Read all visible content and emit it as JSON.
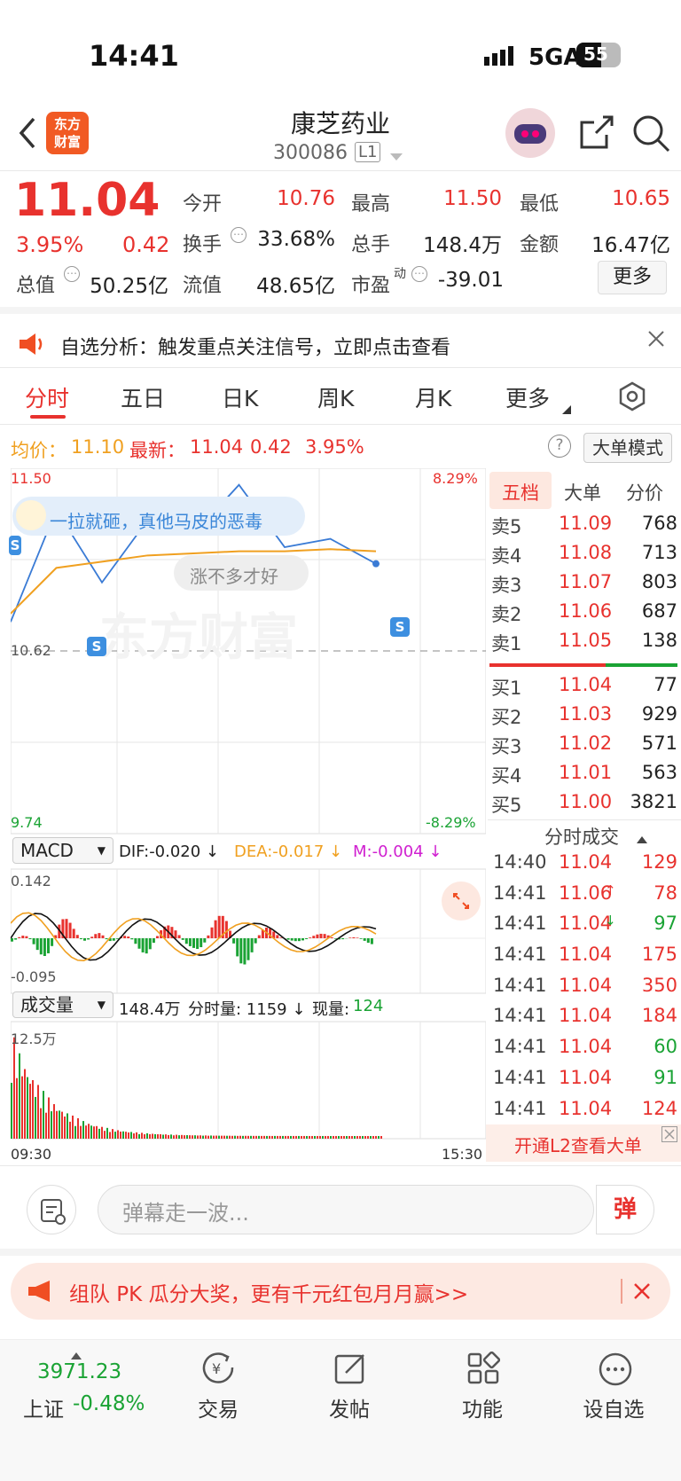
{
  "status": {
    "time": "14:41",
    "network": "5GA",
    "battery": "55"
  },
  "header": {
    "stock_name": "康芝药业",
    "stock_code": "300086",
    "level_badge": "L1",
    "logo_text": "东方\n财富",
    "back_icon": "chevron-left-icon",
    "share_icon": "share-icon",
    "search_icon": "search-icon"
  },
  "quote": {
    "price": "11.04",
    "change_pct": "3.95%",
    "change": "0.42",
    "open_label": "今开",
    "open": "10.76",
    "high_label": "最高",
    "high": "11.50",
    "low_label": "最低",
    "low": "10.65",
    "turnover_label": "换手",
    "turnover": "33.68%",
    "volume_label": "总手",
    "volume": "148.4万",
    "amount_label": "金额",
    "amount": "16.47亿",
    "mktcap_label": "总值",
    "mktcap": "50.25亿",
    "float_label": "流值",
    "float": "48.65亿",
    "pe_label": "市盈",
    "pe_sup": "动",
    "pe": "-39.01",
    "more_label": "更多"
  },
  "notice": {
    "text": "自选分析：触发重点关注信号，立即点击查看"
  },
  "tabs": [
    {
      "label": "分时"
    },
    {
      "label": "五日"
    },
    {
      "label": "日K"
    },
    {
      "label": "周K"
    },
    {
      "label": "月K"
    },
    {
      "label": "更多"
    }
  ],
  "info_row": {
    "avg_label": "均价：",
    "avg": "11.10",
    "last_label": "最新：",
    "last": "11.04",
    "chg": "0.42",
    "pct": "3.95%",
    "mode_btn": "大单模式"
  },
  "chart": {
    "y_high": "11.50",
    "y_ref": "10.62",
    "y_low": "9.74",
    "pct_high": "8.29%",
    "pct_low": "-8.29%",
    "time_start": "09:30",
    "time_end": "15:30",
    "comment_1": "一拉就砸，真他马皮的恶毒",
    "comment_2": "涨不多才好",
    "watermark": "东方财富",
    "macd_label": "MACD",
    "dif": "DIF:-0.020 ↓",
    "dea": "DEA:-0.017 ↓",
    "m": "M:-0.004 ↓",
    "macd_top": "0.142",
    "macd_bottom": "-0.095",
    "vol_label": "成交量",
    "vol_total": "148.4万",
    "vol_fenshi": "分时量: 1159 ↓",
    "vol_now_label": "现量:",
    "vol_now": "124",
    "vol_max": "12.5万",
    "s_mark": "S"
  },
  "chart_data": {
    "type": "line",
    "title": "",
    "x": [
      "09:30",
      "10:00",
      "10:30",
      "11:00",
      "11:30",
      "13:30",
      "14:00",
      "14:30",
      "14:41"
    ],
    "series": [
      {
        "name": "",
        "values": [
          10.76,
          11.3,
          10.95,
          11.25,
          11.18,
          11.42,
          11.12,
          11.16,
          11.04
        ]
      },
      {
        "name": "均价",
        "values": [
          10.8,
          11.02,
          11.05,
          11.08,
          11.09,
          11.1,
          11.1,
          11.11,
          11.1
        ]
      }
    ],
    "ylim": [
      9.74,
      11.5
    ],
    "reference": 10.62
  },
  "order_book": {
    "tabs": [
      {
        "label": "五档"
      },
      {
        "label": "大单"
      },
      {
        "label": "分价"
      }
    ],
    "asks": [
      {
        "label": "卖5",
        "price": "11.09",
        "vol": "768"
      },
      {
        "label": "卖4",
        "price": "11.08",
        "vol": "713"
      },
      {
        "label": "卖3",
        "price": "11.07",
        "vol": "803"
      },
      {
        "label": "卖2",
        "price": "11.06",
        "vol": "687"
      },
      {
        "label": "卖1",
        "price": "11.05",
        "vol": "138"
      }
    ],
    "bids": [
      {
        "label": "买1",
        "price": "11.04",
        "vol": "77"
      },
      {
        "label": "买2",
        "price": "11.03",
        "vol": "929"
      },
      {
        "label": "买3",
        "price": "11.02",
        "vol": "571"
      },
      {
        "label": "买4",
        "price": "11.01",
        "vol": "563"
      },
      {
        "label": "买5",
        "price": "11.00",
        "vol": "3821"
      }
    ],
    "trades_title": "分时成交",
    "trades": [
      {
        "time": "14:40",
        "price": "11.04",
        "vol": "129",
        "dir": ""
      },
      {
        "time": "14:41",
        "price": "11.06",
        "vol": "78",
        "dir": "↑"
      },
      {
        "time": "14:41",
        "price": "11.04",
        "vol": "97",
        "dir": "↓"
      },
      {
        "time": "14:41",
        "price": "11.04",
        "vol": "175",
        "dir": ""
      },
      {
        "time": "14:41",
        "price": "11.04",
        "vol": "350",
        "dir": ""
      },
      {
        "time": "14:41",
        "price": "11.04",
        "vol": "184",
        "dir": ""
      },
      {
        "time": "14:41",
        "price": "11.04",
        "vol": "60",
        "dir": ""
      },
      {
        "time": "14:41",
        "price": "11.04",
        "vol": "91",
        "dir": ""
      },
      {
        "time": "14:41",
        "price": "11.04",
        "vol": "124",
        "dir": ""
      }
    ],
    "l2_text": "开通L2查看大单"
  },
  "danmu": {
    "placeholder": "弹幕走一波...",
    "send_label": "弹"
  },
  "promo": {
    "text": "组队 PK 瓜分大奖，更有千元红包月月赢>>"
  },
  "bottom_nav": {
    "index_value": "3971.23",
    "index_name": "上证",
    "index_pct": "-0.48%",
    "items": [
      {
        "label": "交易"
      },
      {
        "label": "发帖"
      },
      {
        "label": "功能"
      },
      {
        "label": "设自选"
      }
    ]
  }
}
